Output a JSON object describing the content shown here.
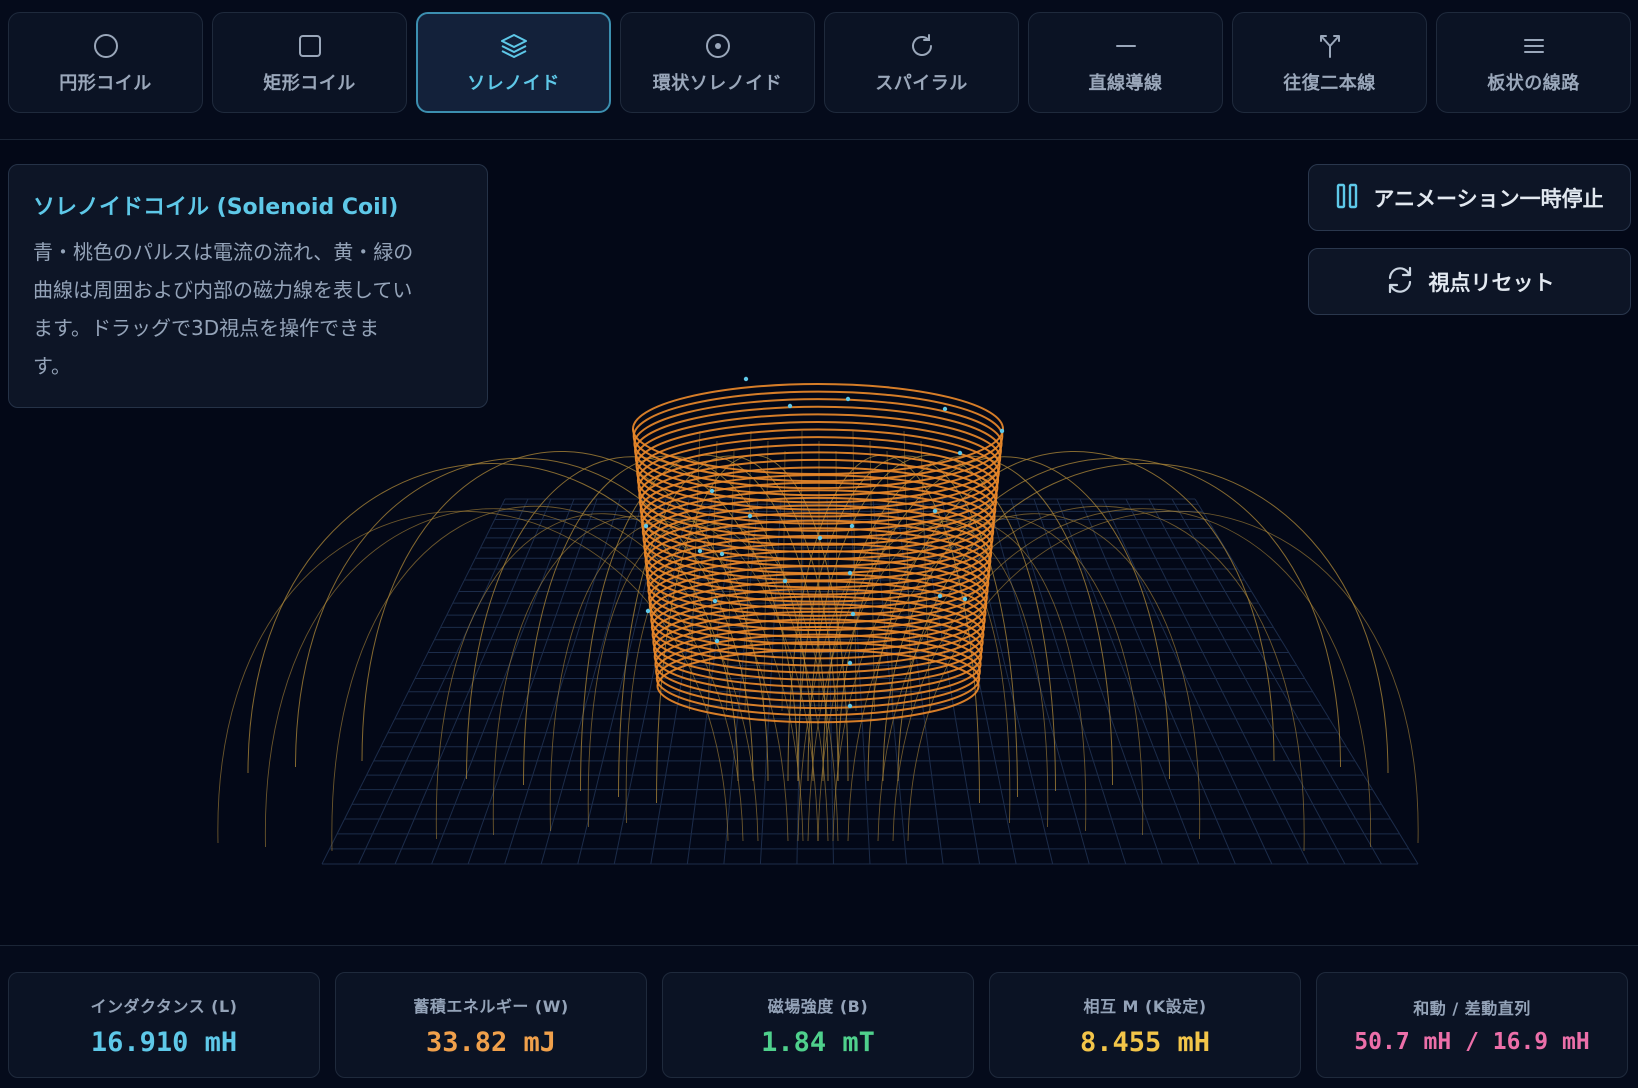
{
  "tabs": [
    {
      "label": "円形コイル",
      "icon": "circle-icon",
      "active": false
    },
    {
      "label": "矩形コイル",
      "icon": "square-icon",
      "active": false
    },
    {
      "label": "ソレノイド",
      "icon": "layers-icon",
      "active": true
    },
    {
      "label": "環状ソレノイド",
      "icon": "target-icon",
      "active": false
    },
    {
      "label": "スパイラル",
      "icon": "rotate-cw-icon",
      "active": false
    },
    {
      "label": "直線導線",
      "icon": "minus-icon",
      "active": false
    },
    {
      "label": "往復二本線",
      "icon": "split-icon",
      "active": false
    },
    {
      "label": "板状の線路",
      "icon": "menu-icon",
      "active": false
    }
  ],
  "info": {
    "title": "ソレノイドコイル (Solenoid Coil)",
    "lines": [
      "青・桃色のパルスは電流の流れ、黄・緑の",
      "曲線は周囲および内部の磁力線を表してい",
      "ます。ドラッグで3D視点を操作できま",
      "す。"
    ]
  },
  "controls": {
    "pause_label": "アニメーション一時停止",
    "reset_label": "視点リセット"
  },
  "stats": [
    {
      "label": "インダクタンス (L)",
      "value": "16.910 mH",
      "color": "#5ec8e8"
    },
    {
      "label": "蓄積エネルギー (W)",
      "value": "33.82 mJ",
      "color": "#f0a04b"
    },
    {
      "label": "磁場強度 (B)",
      "value": "1.84 mT",
      "color": "#4fd08c"
    },
    {
      "label": "相互 M (K設定)",
      "value": "8.455 mH",
      "color": "#f3c549"
    },
    {
      "label": "和動 / 差動直列",
      "value": "50.7 mH / 16.9 mH",
      "color": "#ec6fa9"
    }
  ],
  "colors": {
    "accent": "#5ec8e8",
    "coil": "#e8882a",
    "field_line": "#b08a3a",
    "grid": "#1c2c4a"
  }
}
